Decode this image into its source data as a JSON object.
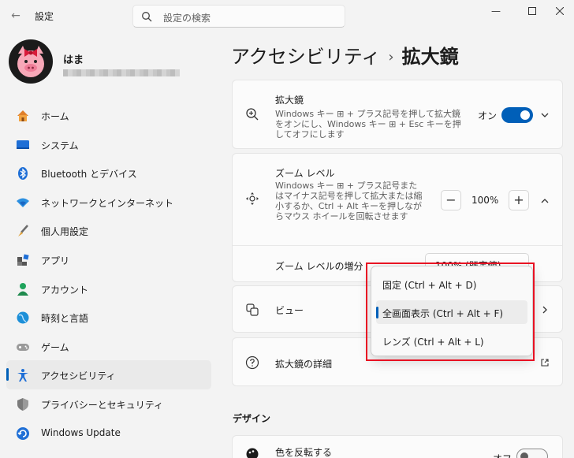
{
  "window": {
    "title": "設定",
    "back_icon": "back-arrow-icon",
    "search_placeholder": "設定の検索"
  },
  "user": {
    "name": "はま"
  },
  "sidebar": {
    "items": [
      {
        "label": "ホーム",
        "icon": "home-icon"
      },
      {
        "label": "システム",
        "icon": "system-icon"
      },
      {
        "label": "Bluetooth とデバイス",
        "icon": "bluetooth-icon"
      },
      {
        "label": "ネットワークとインターネット",
        "icon": "wifi-icon"
      },
      {
        "label": "個人用設定",
        "icon": "brush-icon"
      },
      {
        "label": "アプリ",
        "icon": "apps-icon"
      },
      {
        "label": "アカウント",
        "icon": "account-icon"
      },
      {
        "label": "時刻と言語",
        "icon": "globe-icon"
      },
      {
        "label": "ゲーム",
        "icon": "gamepad-icon"
      },
      {
        "label": "アクセシビリティ",
        "icon": "accessibility-icon",
        "selected": true
      },
      {
        "label": "プライバシーとセキュリティ",
        "icon": "shield-icon"
      },
      {
        "label": "Windows Update",
        "icon": "update-icon"
      }
    ]
  },
  "breadcrumb": {
    "parent": "アクセシビリティ",
    "separator": "›",
    "current": "拡大鏡"
  },
  "magnifier": {
    "title": "拡大鏡",
    "description": "Windows キー ⊞ + プラス記号を押して拡大鏡をオンにし、Windows キー ⊞ + Esc キーを押してオフにします",
    "state_label": "オン"
  },
  "zoom": {
    "title": "ズーム レベル",
    "description": "Windows キー ⊞ + プラス記号またはマイナス記号を押して拡大または縮小するか、Ctrl + Alt キーを押しながらマウス ホイールを回転させます",
    "minus": "−",
    "value": "100%",
    "plus": "+"
  },
  "zoom_increment": {
    "label": "ズーム レベルの増分",
    "value": "100% (既定値)"
  },
  "view": {
    "label": "ビュー"
  },
  "view_options": [
    {
      "label": "固定 (Ctrl + Alt + D)",
      "selected": false
    },
    {
      "label": "全画面表示 (Ctrl + Alt + F)",
      "selected": true
    },
    {
      "label": "レンズ (Ctrl + Alt + L)",
      "selected": false
    }
  ],
  "details": {
    "label": "拡大鏡の詳細"
  },
  "design": {
    "heading": "デザイン",
    "invert_label": "色を反転する",
    "invert_state": "オフ"
  },
  "colors": {
    "accent": "#005fb8",
    "highlight_box": "#e81123"
  }
}
